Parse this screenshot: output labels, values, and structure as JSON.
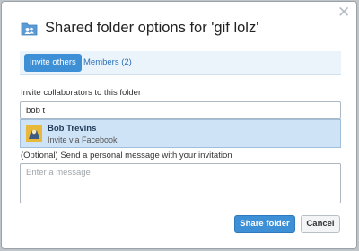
{
  "dialog": {
    "title": "Shared folder options for 'gif lolz'",
    "close_icon": "close-icon",
    "folder_icon": "shared-folder-icon"
  },
  "tabs": [
    {
      "label": "Invite others",
      "active": true
    },
    {
      "label": "Members (2)",
      "active": false
    }
  ],
  "invite": {
    "label": "Invite collaborators to this folder",
    "value": "bob t",
    "suggestion": {
      "name": "Bob Trevins",
      "sub": "Invite via Facebook",
      "avatar_icon": "avatar-icon"
    }
  },
  "message": {
    "label": "(Optional) Send a personal message with your invitation",
    "placeholder": "Enter a message"
  },
  "buttons": {
    "share": "Share folder",
    "cancel": "Cancel"
  },
  "colors": {
    "accent": "#3d8fd6",
    "tab_bar_bg": "#ebf4fb",
    "suggestion_bg": "#cfe3f6"
  }
}
